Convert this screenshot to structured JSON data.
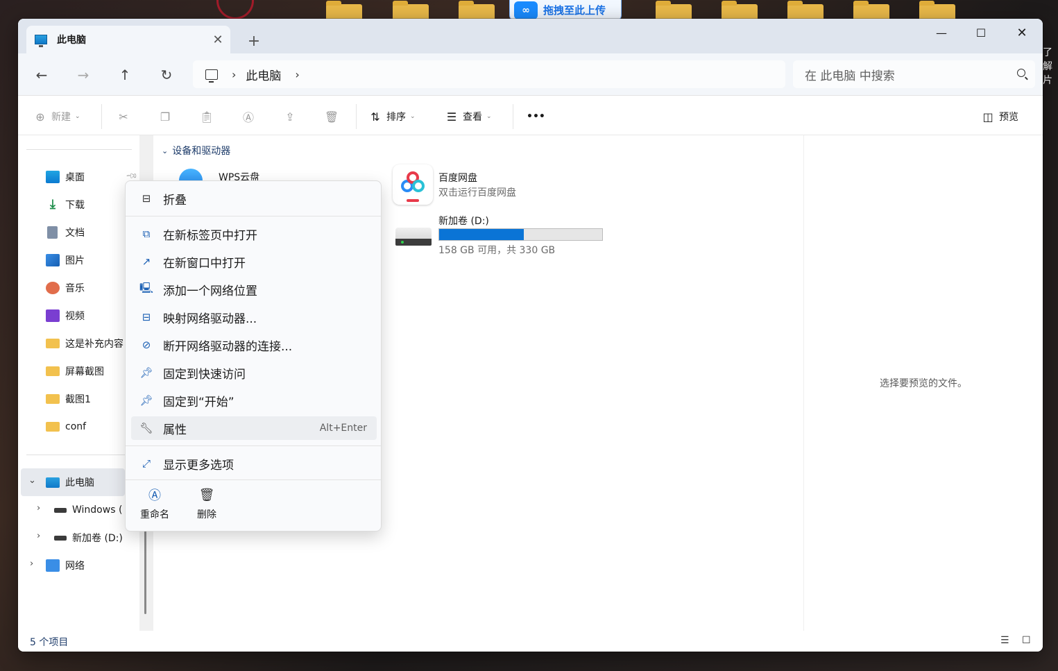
{
  "desktop": {
    "upload_banner": "拖拽至此上传",
    "upload_logo": "∞",
    "side_text": "了解\n片"
  },
  "window": {
    "tab_title": "此电脑",
    "tab_close": "✕",
    "new_tab": "+",
    "minimize": "—",
    "maximize": "☐",
    "close": "✕"
  },
  "nav": {
    "back": "←",
    "forward": "→",
    "up": "↑",
    "refresh": "↻",
    "breadcrumb": "此电脑",
    "search_placeholder": "在 此电脑 中搜索"
  },
  "toolbar": {
    "new_label": "新建",
    "sort_label": "排序",
    "view_label": "查看",
    "more_label": "•••",
    "preview_label": "预览"
  },
  "sidebar": {
    "quick_access": [
      {
        "label": "桌面",
        "icon": "desktop-icon"
      },
      {
        "label": "下载",
        "icon": "download-icon"
      },
      {
        "label": "文档",
        "icon": "document-icon"
      },
      {
        "label": "图片",
        "icon": "pictures-icon"
      },
      {
        "label": "音乐",
        "icon": "music-icon"
      },
      {
        "label": "视频",
        "icon": "video-icon"
      },
      {
        "label": "这是补充内容",
        "icon": "folder-icon"
      },
      {
        "label": "屏幕截图",
        "icon": "folder-icon"
      },
      {
        "label": "截图1",
        "icon": "folder-icon"
      },
      {
        "label": "conf",
        "icon": "folder-icon"
      }
    ],
    "this_pc": "此电脑",
    "windows_drive": "Windows (",
    "d_drive": "新加卷 (D:)",
    "network": "网络"
  },
  "content": {
    "group_header": "设备和驱动器",
    "items": {
      "wps_name": "WPS云盘",
      "baidu_name": "百度网盘",
      "baidu_sub": "双击运行百度网盘",
      "drive_name": "新加卷 (D:)",
      "drive_space": "158 GB 可用，共 330 GB",
      "drive_used_fraction": 0.52
    }
  },
  "preview_pane": {
    "message": "选择要预览的文件。"
  },
  "status": {
    "count": "5 个项目"
  },
  "context_menu": {
    "collapse": "折叠",
    "open_new_tab": "在新标签页中打开",
    "open_new_window": "在新窗口中打开",
    "add_network_location": "添加一个网络位置",
    "map_network_drive": "映射网络驱动器...",
    "disconnect_network_drive": "断开网络驱动器的连接...",
    "pin_quick_access": "固定到快速访问",
    "pin_start": "固定到“开始”",
    "properties": "属性",
    "properties_shortcut": "Alt+Enter",
    "show_more": "显示更多选项",
    "rename": "重命名",
    "delete": "删除"
  }
}
